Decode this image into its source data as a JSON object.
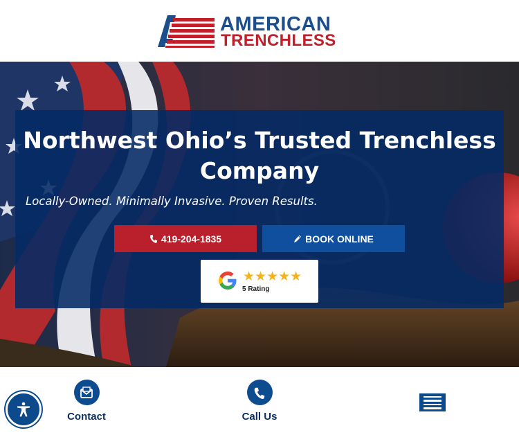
{
  "header": {
    "logo_line1": "AMERICAN",
    "logo_line2": "TRENCHLESS"
  },
  "hero": {
    "title": "Northwest Ohio’s Trusted Trenchless Company",
    "subtitle": "Locally-Owned. Minimally Invasive. Proven Results.",
    "phone_button": {
      "label": "419-204-1835",
      "icon": "phone-icon"
    },
    "book_button": {
      "label": "BOOK ONLINE",
      "icon": "pencil-icon"
    },
    "review": {
      "stars": "★★★★★",
      "rating_text": "5 Rating",
      "icon": "google-icon"
    }
  },
  "bottom_nav": {
    "contact": {
      "label": "Contact",
      "icon": "envelope-icon"
    },
    "call": {
      "label": "Call Us",
      "icon": "phone-icon"
    },
    "menu": {
      "icon": "hamburger-menu-icon"
    },
    "accessibility": {
      "icon": "accessibility-icon"
    }
  },
  "colors": {
    "brand_blue": "#0f4f9e",
    "brand_red": "#b9202c",
    "panel_navy": "#032a65",
    "star_gold": "#f6b21b"
  }
}
